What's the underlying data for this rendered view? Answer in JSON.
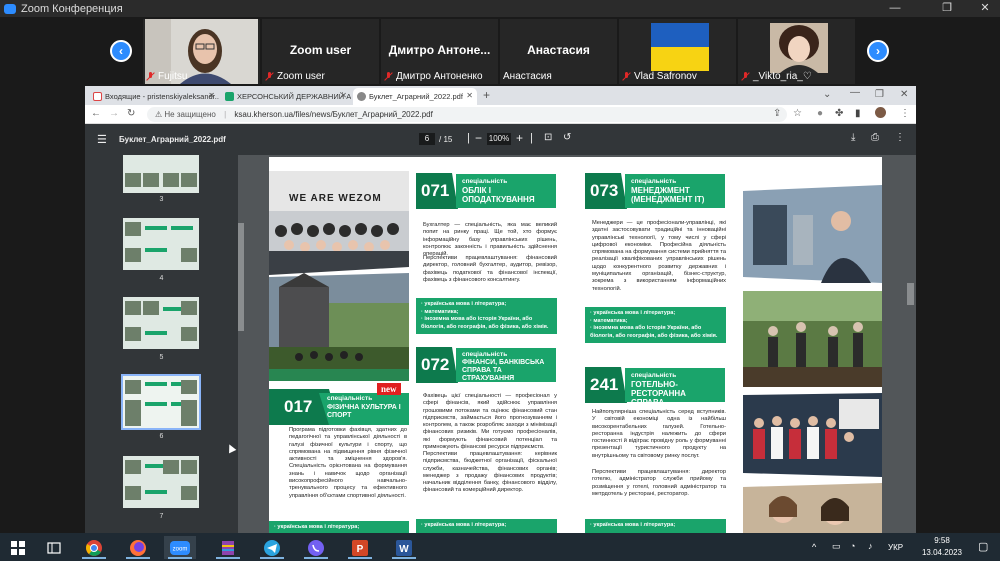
{
  "zoom": {
    "window_title": "Zoom Конференция",
    "participants": [
      {
        "label": "Fujitsu",
        "display": ""
      },
      {
        "label": "Zoom user",
        "display": "Zoom user"
      },
      {
        "label": "Дмитро Антоненко",
        "display": "Дмитро Антоне..."
      },
      {
        "label": "Анастасия",
        "display": "Анастасия"
      },
      {
        "label": "Vlad Safronov",
        "display": ""
      },
      {
        "label": "_Vikto_ria_♡",
        "display": ""
      }
    ]
  },
  "browser": {
    "tabs": [
      {
        "label": "Входящие - pristenskiyaleksandr..."
      },
      {
        "label": "ХЕРСОНСЬКИЙ ДЕРЖАВНИЙ АГРАР..."
      },
      {
        "label": "Буклет_Аграрний_2022.pdf"
      }
    ],
    "new_tab": "+",
    "address": {
      "security": "Не защищено",
      "url": "ksau.kherson.ua/files/news/Буклет_Аграрний_2022.pdf"
    }
  },
  "pdf": {
    "filename": "Буклет_Аграрний_2022.pdf",
    "page_current": "6",
    "page_total": "/ 15",
    "zoom": "100%",
    "thumbnails": [
      {
        "num": "3"
      },
      {
        "num": "4"
      },
      {
        "num": "5"
      },
      {
        "num": "6"
      },
      {
        "num": "7"
      }
    ],
    "content": {
      "wezom_sign": "WE ARE WEZOM",
      "new_badge": "new",
      "s017": {
        "num": "017",
        "sub": "спеціальність",
        "title": "ФІЗИЧНА КУЛЬТУРА І СПОРТ",
        "text": "Програма підготовки фахівця, здатних до педагогічної та управлінської діяльності в галузі фізичної культури і спорту, що спрямована на підвищення рівня фізичної активності та зміцнення здоров'я. Спеціальність орієнтована на формування знань і навичок щодо організації високопрофесійного навчально-тренувального процесу та ефективного управління об'єктами спортивної діяльності.",
        "subj_partial": "· українська мова і література;"
      },
      "s071": {
        "num": "071",
        "sub": "спеціальність",
        "title": "ОБЛІК І ОПОДАТКУВАННЯ",
        "text": "Бухгалтер — спеціальність, яка має великий попит на ринку праці. Ще той, хто формує інформаційну базу управлінських рішень, контролює законність і правильність здійснення операцій.",
        "text2": "Перспективи працевлаштування: фінансовий директор, головний бухгалтер, аудитор, ревізор, фахівець податкової та фінансової інспекції, фахівець з фінансового консалтингу.",
        "subjects": [
          "· українська мова і література;",
          "· математика;",
          "· іноземна мова або історія України, або біологія, або географія, або фізика, або хімія."
        ]
      },
      "s072": {
        "num": "072",
        "sub": "спеціальність",
        "title": "ФІНАНСИ, БАНКІВСЬКА СПРАВА ТА СТРАХУВАННЯ",
        "text": "Фахівець цієї спеціальності — професіонал у сфері фінансів, який здійснює управління грошовими потоками та оцінює фінансовий стан підприємств, займається його прогнозуванням і контролем, а також розробляє заходи з мінімізації фінансових ризиків. Ми готуємо професіоналів, які формують фінансовий потенціал та примножують фінансові ресурси підприємств.",
        "text2": "Перспективи працевлаштування: керівник підприємства, бюджетної організації, фіскальної служби, казначейства, фінансових органів; менеджер з продажу фінансових продуктів; начальник відділення банку, фінансового відділу, фінансовий та комерційний директор.",
        "subj_partial": "· українська мова і література;"
      },
      "s073": {
        "num": "073",
        "sub": "спеціальність",
        "title": "МЕНЕДЖМЕНТ (МЕНЕДЖМЕНТ ІТ)",
        "text": "Менеджери — це професіонали-управлінці, які здатні застосовувати традиційні та інноваційні управлінські технології, у тому числі у сфері цифрової економіки. Професійна діяльність спрямована на формування системи прийняття та реалізації кваліфікованих управлінських рішень щодо конкурентного розвитку державних і муніципальних організацій, бізнес-структур, зокрема з використанням інформаційних технологій.",
        "subjects": [
          "· українська мова і література;",
          "· математика;",
          "· іноземна мова або історія України, або біологія, або географія, або фізика, або хімія."
        ]
      },
      "s241": {
        "num": "241",
        "sub": "спеціальність",
        "title": "ГОТЕЛЬНО-РЕСТОРАННА СПРАВА",
        "text": "Найпопулярніша спеціальність серед вступників. У світовій економіці одна із найбільш високорентабельних галузей. Готельно-ресторанна індустрія належить до сфери гостинності й відіграє провідну роль у формуванні презентації туристичного продукту на внутрішньому та світовому ринку послуг.",
        "text2": "Перспективи працевлаштування: директор готелю, адміністратор служби прийому та розміщення у готелі, головний адміністратор та метрдотель у ресторані, ресторатор.",
        "subj_partial": "· українська мова і література;"
      }
    }
  },
  "taskbar": {
    "lang": "УКР",
    "time": "9:58",
    "date": "13.04.2023",
    "apps": [
      "start",
      "task-view",
      "chrome",
      "firefox",
      "zoom",
      "winrar",
      "telegram",
      "viber",
      "powerpoint",
      "word"
    ]
  },
  "colors": {
    "accent_green": "#1aa46b",
    "dark_green": "#0d7a4d",
    "zoom_blue": "#2d8cff",
    "taskbar": "#1f2a33",
    "pdf_toolbar": "#323639"
  }
}
